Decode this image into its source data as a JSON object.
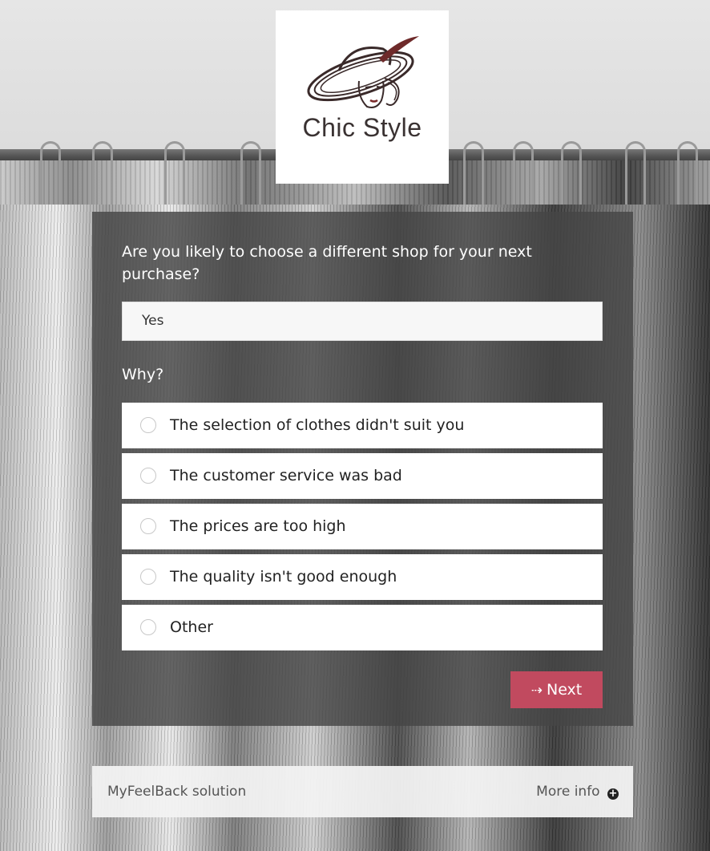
{
  "brand": {
    "logo_text": "Chic Style"
  },
  "survey": {
    "question": "Are you likely to choose a different shop for your next purchase?",
    "answer_value": "Yes",
    "why_label": "Why?",
    "options": [
      {
        "label": "The selection of clothes didn't suit you",
        "selected": false
      },
      {
        "label": "The customer service was bad",
        "selected": false
      },
      {
        "label": "The prices are too high",
        "selected": false
      },
      {
        "label": "The quality isn't good enough",
        "selected": false
      },
      {
        "label": "Other",
        "selected": false
      }
    ],
    "next_arrow": "⇢",
    "next_label": "Next"
  },
  "footer": {
    "brand_text": "MyFeelBack solution",
    "more_info_label": "More info",
    "more_info_icon": "plus-circle-icon"
  },
  "colors": {
    "accent": "#c14a5f",
    "panel": "#464646",
    "option_bg": "#ffffff",
    "logo_text": "#3a3232"
  }
}
